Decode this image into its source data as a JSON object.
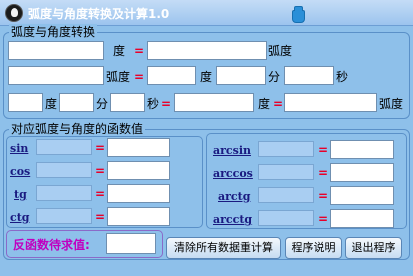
{
  "window": {
    "title": "弧度与角度转换及计算1.0",
    "close_icon": "close-icon"
  },
  "convert": {
    "legend": "弧度与角度转换",
    "row1": {
      "degree_unit": "度",
      "equals": "=",
      "radian_unit": "弧度"
    },
    "row2": {
      "radian_unit": "弧度",
      "equals": "=",
      "degree_unit": "度",
      "minute_unit": "分",
      "second_unit": "秒"
    },
    "row3": {
      "degree_unit": "度",
      "minute_unit": "分",
      "second_unit": "秒",
      "equals": "=",
      "degree_unit2": "度",
      "equals2": "=",
      "radian_unit": "弧度"
    }
  },
  "functions": {
    "legend": "对应弧度与角度的函数值",
    "left": [
      {
        "name": "sin",
        "equals": "="
      },
      {
        "name": "cos",
        "equals": "="
      },
      {
        "name": "tg",
        "equals": "="
      },
      {
        "name": "ctg",
        "equals": "="
      }
    ],
    "right": [
      {
        "name": "arcsin",
        "equals": "="
      },
      {
        "name": "arccos",
        "equals": "="
      },
      {
        "name": "arctg",
        "equals": "="
      },
      {
        "name": "arcctg",
        "equals": "="
      }
    ]
  },
  "inverse": {
    "label": "反函数待求值:"
  },
  "buttons": {
    "clear": "清除所有数据重计算",
    "help": "程序说明",
    "exit": "退出程序"
  }
}
